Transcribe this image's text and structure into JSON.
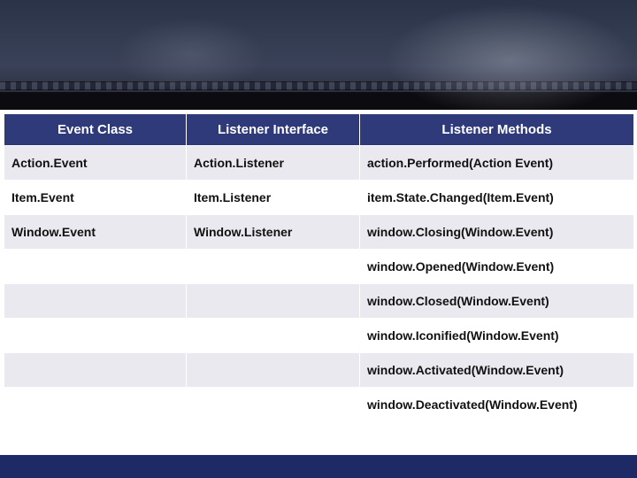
{
  "table": {
    "headers": [
      "Event Class",
      "Listener Interface",
      "Listener Methods"
    ],
    "rows": [
      [
        "Action.Event",
        "Action.Listener",
        "action.Performed(Action Event)"
      ],
      [
        "Item.Event",
        "Item.Listener",
        "item.State.Changed(Item.Event)"
      ],
      [
        "Window.Event",
        "Window.Listener",
        "window.Closing(Window.Event)"
      ],
      [
        "",
        "",
        "window.Opened(Window.Event)"
      ],
      [
        "",
        "",
        "window.Closed(Window.Event)"
      ],
      [
        "",
        "",
        "window.Iconified(Window.Event)"
      ],
      [
        "",
        "",
        "window.Activated(Window.Event)"
      ],
      [
        "",
        "",
        "window.Deactivated(Window.Event)"
      ]
    ]
  }
}
